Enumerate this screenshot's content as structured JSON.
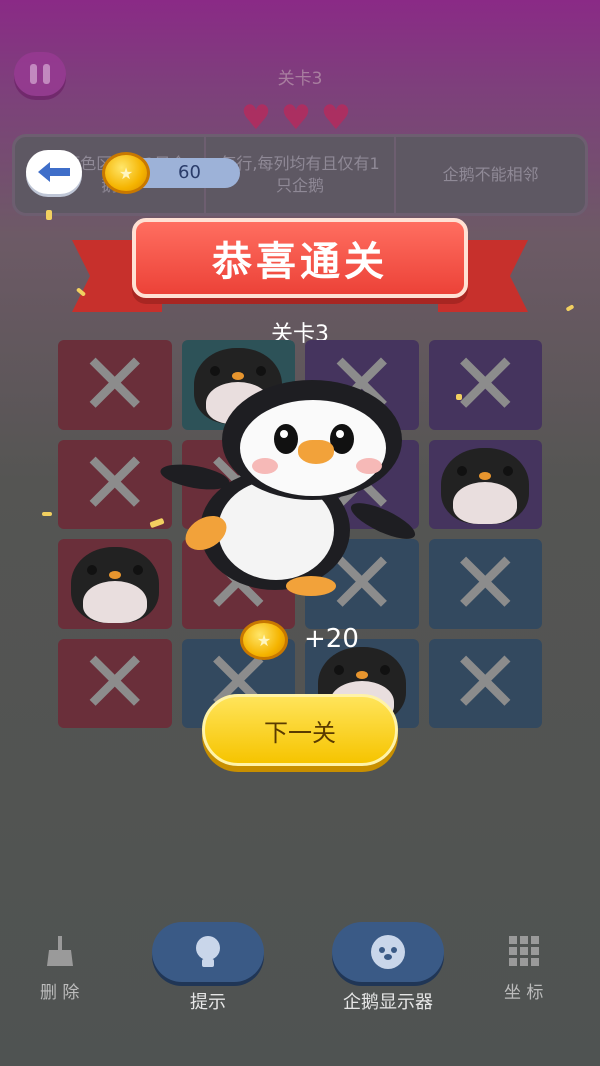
{
  "top": {
    "level_title": "关卡3",
    "hearts": 3
  },
  "rules": [
    {
      "text": "每个颜色区域有1只企鹅"
    },
    {
      "text": "每行,每列均有且仅有1只企鹅"
    },
    {
      "text": "企鹅不能相邻"
    }
  ],
  "coins": {
    "amount": "60"
  },
  "dialog": {
    "banner_title": "恭喜通关",
    "level_label": "关卡3",
    "reward_text": "+20",
    "next_button": "下一关"
  },
  "grid": {
    "rows": [
      [
        "x",
        "penguin",
        "x",
        "x"
      ],
      [
        "x",
        "x",
        "x",
        "penguin"
      ],
      [
        "penguin",
        "x",
        "x",
        "x"
      ],
      [
        "x",
        "x",
        "penguin",
        "x"
      ]
    ]
  },
  "toolbar": {
    "delete_label": "删 除",
    "hint_label": "提示",
    "display_label": "企鹅显示器",
    "coords_label": "坐 标"
  },
  "colors": {
    "banner": "#ec4238",
    "next_button": "#f6c400",
    "coin": "#f5b400"
  }
}
